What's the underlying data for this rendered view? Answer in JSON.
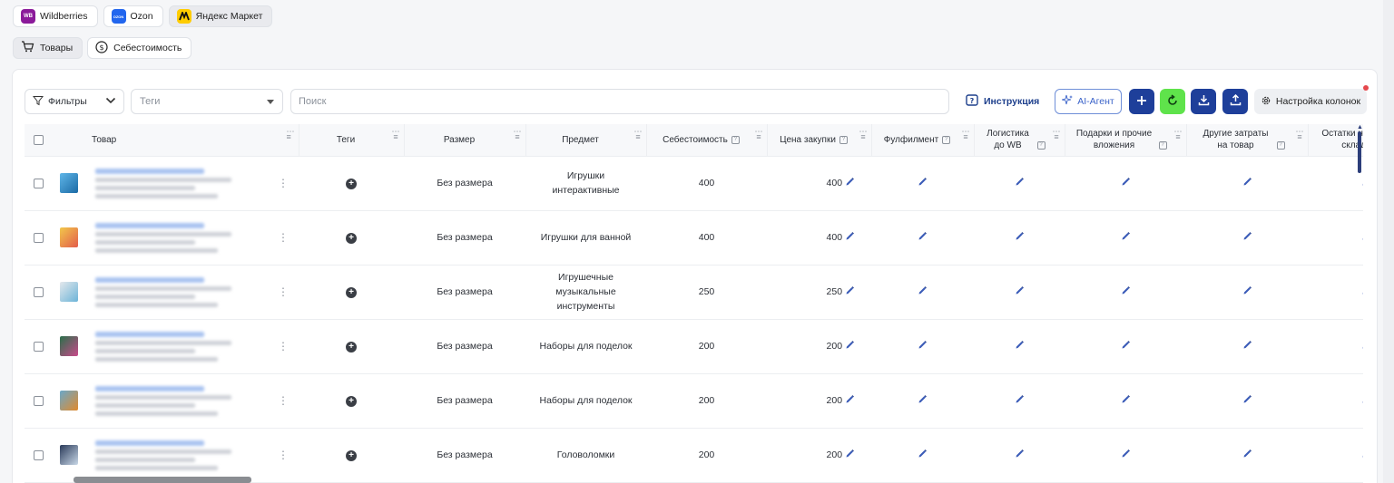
{
  "marketplaces": [
    {
      "label": "Wildberries",
      "logo_text": "WB",
      "color": "#8b1a9a",
      "active": false
    },
    {
      "label": "Ozon",
      "logo_text": "OZON",
      "color": "#2266ee",
      "active": false
    },
    {
      "label": "Яндекс Маркет",
      "logo_text": "",
      "color": "#ffcc00",
      "active": true
    }
  ],
  "sections": [
    {
      "label": "Товары",
      "icon": "cart-icon",
      "active": true
    },
    {
      "label": "Себестоимость",
      "icon": "dollar-circle-icon",
      "active": false
    }
  ],
  "toolbar": {
    "filters_label": "Фильтры",
    "tags_placeholder": "Теги",
    "search_placeholder": "Поиск",
    "instruction_label": "Инструкция",
    "ai_label": "AI-Агент",
    "columns_label": "Настройка колонок",
    "accent": "#1e3f9a",
    "refresh_color": "#5fe34b"
  },
  "table": {
    "columns": [
      "Товар",
      "Теги",
      "Размер",
      "Предмет",
      "Себестоимость",
      "Цена закупки",
      "Фулфилмент",
      "Логистика до WB",
      "Подарки и прочие вложения",
      "Другие затраты на товар",
      "Остатки на в складах"
    ],
    "rows": [
      {
        "size": "Без размера",
        "subject": "Игрушки интерактивные",
        "cost": "400",
        "price": "400"
      },
      {
        "size": "Без размера",
        "subject": "Игрушки для ванной",
        "cost": "400",
        "price": "400"
      },
      {
        "size": "Без размера",
        "subject": "Игрушечные музыкальные инструменты",
        "cost": "250",
        "price": "250"
      },
      {
        "size": "Без размера",
        "subject": "Наборы для поделок",
        "cost": "200",
        "price": "200"
      },
      {
        "size": "Без размера",
        "subject": "Наборы для поделок",
        "cost": "200",
        "price": "200"
      },
      {
        "size": "Без размера",
        "subject": "Головоломки",
        "cost": "200",
        "price": "200"
      }
    ]
  }
}
